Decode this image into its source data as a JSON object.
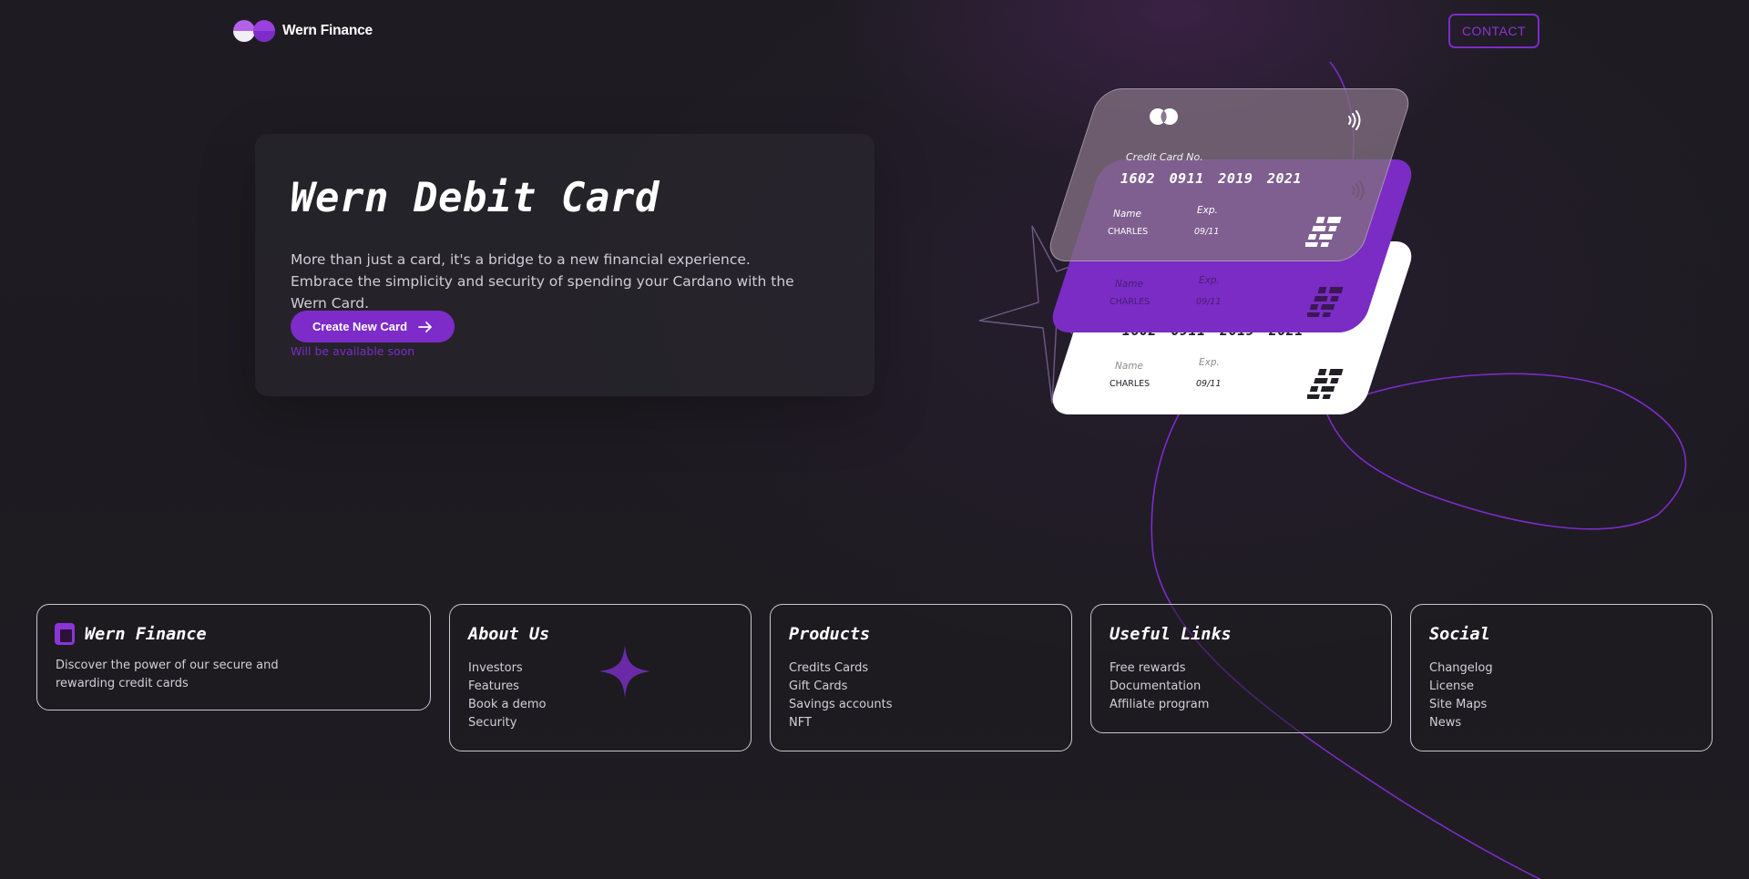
{
  "header": {
    "brand": "Wern Finance",
    "contact_label": "CONTACT"
  },
  "hero": {
    "title": "Wern Debit Card",
    "description": "More than just a card, it's a bridge to a new financial experience. Embrace the simplicity and security of spending your Cardano with the Wern Card.",
    "cta_label": "Create New Card",
    "cta_note": "Will be available soon"
  },
  "card": {
    "number_label": "Credit Card No.",
    "number": "1602 0911 2019 2021",
    "name_label": "Name",
    "name": "CHARLES",
    "exp_label": "Exp.",
    "exp": "09/11"
  },
  "footer": {
    "brand": {
      "title": "Wern Finance",
      "description": "Discover the power of our secure and rewarding credit cards"
    },
    "about": {
      "title": "About Us",
      "items": [
        "Investors",
        "Features",
        "Book a demo",
        "Security"
      ]
    },
    "products": {
      "title": "Products",
      "items": [
        "Credits Cards",
        "Gift Cards",
        "Savings accounts",
        "NFT"
      ]
    },
    "links": {
      "title": "Useful Links",
      "items": [
        "Free rewards",
        "Documentation",
        "Affiliate program"
      ]
    },
    "social": {
      "title": "Social",
      "items": [
        "Changelog",
        "License",
        "Site Maps",
        "News"
      ]
    }
  },
  "colors": {
    "accent": "#7d2bc9",
    "background": "#1e1c22",
    "card_purple": "#7a2cc4"
  },
  "icons": [
    "logo-mark-icon",
    "arrow-right-icon",
    "card-network-icon",
    "contactless-icon",
    "card-chip-icon",
    "four-point-star-icon",
    "brand-square-icon"
  ]
}
